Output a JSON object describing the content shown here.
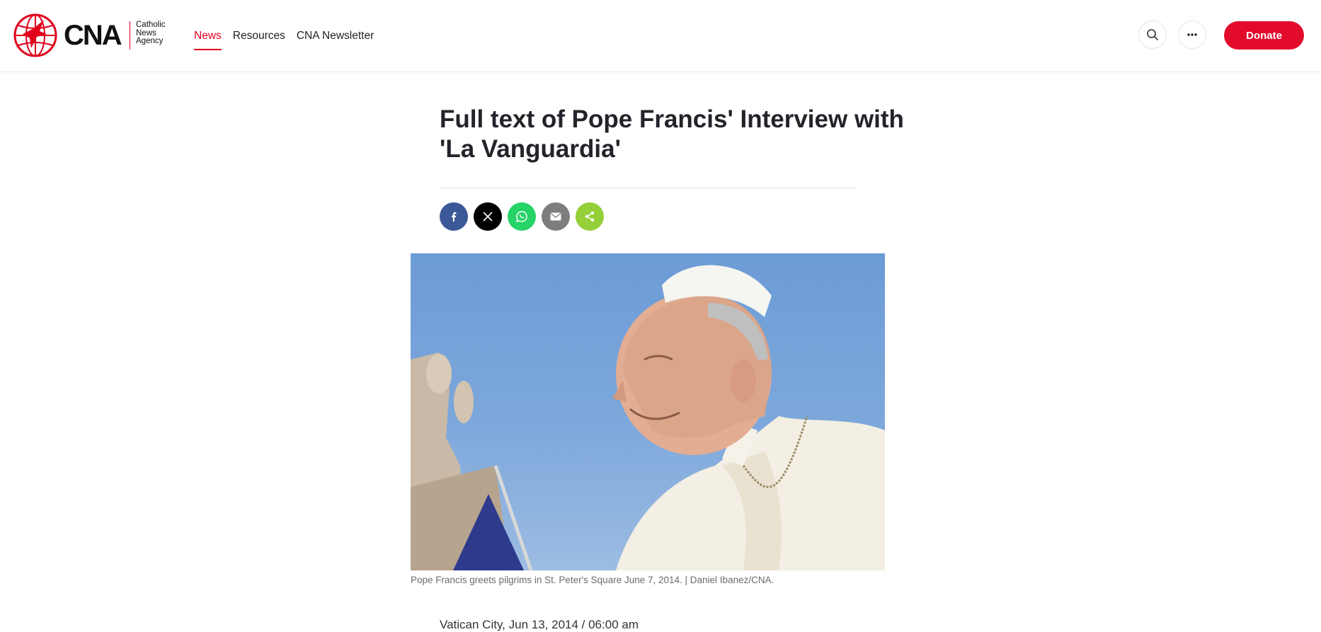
{
  "brand": {
    "name": "CNA",
    "sub_lines": [
      "Catholic",
      "News",
      "Agency"
    ],
    "accent": "#e0001b"
  },
  "nav": {
    "items": [
      {
        "label": "News",
        "active": true
      },
      {
        "label": "Resources",
        "active": false
      },
      {
        "label": "CNA Newsletter",
        "active": false
      }
    ]
  },
  "header_actions": {
    "search_icon": "search-icon",
    "more_icon": "more-horizontal-icon",
    "donate_label": "Donate",
    "donate_color": "#e30b2c"
  },
  "article": {
    "title": "Full text of Pope Francis' Interview with 'La Vanguardia'",
    "share": [
      {
        "name": "facebook",
        "icon": "facebook-icon",
        "color": "#3b5998"
      },
      {
        "name": "x",
        "icon": "x-icon",
        "color": "#000000"
      },
      {
        "name": "whatsapp",
        "icon": "whatsapp-icon",
        "color": "#25d366"
      },
      {
        "name": "email",
        "icon": "email-icon",
        "color": "#7d7d7d"
      },
      {
        "name": "share",
        "icon": "share-icon",
        "color": "#95d03a"
      }
    ],
    "image_caption": "Pope Francis greets pilgrims in St. Peter's Square June 7, 2014. | Daniel Ibanez/CNA.",
    "dateline": "Vatican City, Jun 13, 2014 / 06:00 am"
  }
}
